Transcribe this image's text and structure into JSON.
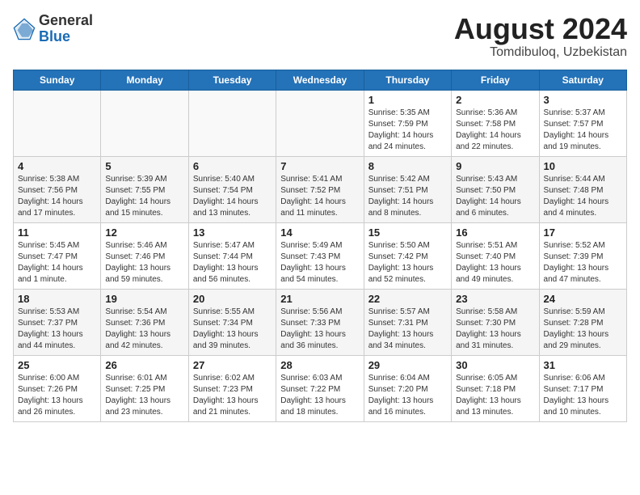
{
  "logo": {
    "general": "General",
    "blue": "Blue"
  },
  "title": {
    "month_year": "August 2024",
    "location": "Tomdibuloq, Uzbekistan"
  },
  "headers": [
    "Sunday",
    "Monday",
    "Tuesday",
    "Wednesday",
    "Thursday",
    "Friday",
    "Saturday"
  ],
  "weeks": [
    [
      {
        "day": "",
        "info": ""
      },
      {
        "day": "",
        "info": ""
      },
      {
        "day": "",
        "info": ""
      },
      {
        "day": "",
        "info": ""
      },
      {
        "day": "1",
        "info": "Sunrise: 5:35 AM\nSunset: 7:59 PM\nDaylight: 14 hours\nand 24 minutes."
      },
      {
        "day": "2",
        "info": "Sunrise: 5:36 AM\nSunset: 7:58 PM\nDaylight: 14 hours\nand 22 minutes."
      },
      {
        "day": "3",
        "info": "Sunrise: 5:37 AM\nSunset: 7:57 PM\nDaylight: 14 hours\nand 19 minutes."
      }
    ],
    [
      {
        "day": "4",
        "info": "Sunrise: 5:38 AM\nSunset: 7:56 PM\nDaylight: 14 hours\nand 17 minutes."
      },
      {
        "day": "5",
        "info": "Sunrise: 5:39 AM\nSunset: 7:55 PM\nDaylight: 14 hours\nand 15 minutes."
      },
      {
        "day": "6",
        "info": "Sunrise: 5:40 AM\nSunset: 7:54 PM\nDaylight: 14 hours\nand 13 minutes."
      },
      {
        "day": "7",
        "info": "Sunrise: 5:41 AM\nSunset: 7:52 PM\nDaylight: 14 hours\nand 11 minutes."
      },
      {
        "day": "8",
        "info": "Sunrise: 5:42 AM\nSunset: 7:51 PM\nDaylight: 14 hours\nand 8 minutes."
      },
      {
        "day": "9",
        "info": "Sunrise: 5:43 AM\nSunset: 7:50 PM\nDaylight: 14 hours\nand 6 minutes."
      },
      {
        "day": "10",
        "info": "Sunrise: 5:44 AM\nSunset: 7:48 PM\nDaylight: 14 hours\nand 4 minutes."
      }
    ],
    [
      {
        "day": "11",
        "info": "Sunrise: 5:45 AM\nSunset: 7:47 PM\nDaylight: 14 hours\nand 1 minute."
      },
      {
        "day": "12",
        "info": "Sunrise: 5:46 AM\nSunset: 7:46 PM\nDaylight: 13 hours\nand 59 minutes."
      },
      {
        "day": "13",
        "info": "Sunrise: 5:47 AM\nSunset: 7:44 PM\nDaylight: 13 hours\nand 56 minutes."
      },
      {
        "day": "14",
        "info": "Sunrise: 5:49 AM\nSunset: 7:43 PM\nDaylight: 13 hours\nand 54 minutes."
      },
      {
        "day": "15",
        "info": "Sunrise: 5:50 AM\nSunset: 7:42 PM\nDaylight: 13 hours\nand 52 minutes."
      },
      {
        "day": "16",
        "info": "Sunrise: 5:51 AM\nSunset: 7:40 PM\nDaylight: 13 hours\nand 49 minutes."
      },
      {
        "day": "17",
        "info": "Sunrise: 5:52 AM\nSunset: 7:39 PM\nDaylight: 13 hours\nand 47 minutes."
      }
    ],
    [
      {
        "day": "18",
        "info": "Sunrise: 5:53 AM\nSunset: 7:37 PM\nDaylight: 13 hours\nand 44 minutes."
      },
      {
        "day": "19",
        "info": "Sunrise: 5:54 AM\nSunset: 7:36 PM\nDaylight: 13 hours\nand 42 minutes."
      },
      {
        "day": "20",
        "info": "Sunrise: 5:55 AM\nSunset: 7:34 PM\nDaylight: 13 hours\nand 39 minutes."
      },
      {
        "day": "21",
        "info": "Sunrise: 5:56 AM\nSunset: 7:33 PM\nDaylight: 13 hours\nand 36 minutes."
      },
      {
        "day": "22",
        "info": "Sunrise: 5:57 AM\nSunset: 7:31 PM\nDaylight: 13 hours\nand 34 minutes."
      },
      {
        "day": "23",
        "info": "Sunrise: 5:58 AM\nSunset: 7:30 PM\nDaylight: 13 hours\nand 31 minutes."
      },
      {
        "day": "24",
        "info": "Sunrise: 5:59 AM\nSunset: 7:28 PM\nDaylight: 13 hours\nand 29 minutes."
      }
    ],
    [
      {
        "day": "25",
        "info": "Sunrise: 6:00 AM\nSunset: 7:26 PM\nDaylight: 13 hours\nand 26 minutes."
      },
      {
        "day": "26",
        "info": "Sunrise: 6:01 AM\nSunset: 7:25 PM\nDaylight: 13 hours\nand 23 minutes."
      },
      {
        "day": "27",
        "info": "Sunrise: 6:02 AM\nSunset: 7:23 PM\nDaylight: 13 hours\nand 21 minutes."
      },
      {
        "day": "28",
        "info": "Sunrise: 6:03 AM\nSunset: 7:22 PM\nDaylight: 13 hours\nand 18 minutes."
      },
      {
        "day": "29",
        "info": "Sunrise: 6:04 AM\nSunset: 7:20 PM\nDaylight: 13 hours\nand 16 minutes."
      },
      {
        "day": "30",
        "info": "Sunrise: 6:05 AM\nSunset: 7:18 PM\nDaylight: 13 hours\nand 13 minutes."
      },
      {
        "day": "31",
        "info": "Sunrise: 6:06 AM\nSunset: 7:17 PM\nDaylight: 13 hours\nand 10 minutes."
      }
    ]
  ]
}
